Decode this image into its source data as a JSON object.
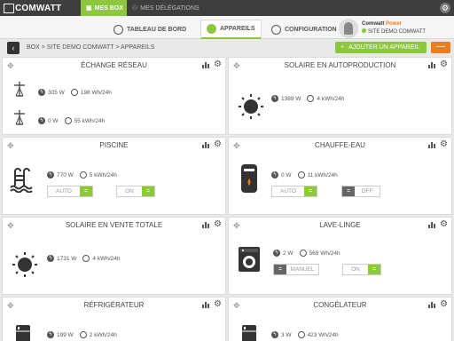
{
  "app": {
    "logo_text": "COMWATT",
    "tabs": {
      "mes_box": "MES BOX",
      "delegations": "MES DÉLÉGATIONS"
    }
  },
  "nav": {
    "tableau": "TABLEAU DE BORD",
    "appareils": "APPAREILS",
    "configuration": "CONFIGURATION"
  },
  "user": {
    "name": "Comwatt",
    "plan": "Power",
    "site": "SITE DEMO COMWATT"
  },
  "breadcrumb": "BOX > SITE DEMO COMWATT > APPAREILS",
  "actions": {
    "add": "AJOUTER UN APPAREIL",
    "remove": "—"
  },
  "colors": {
    "accent": "#8dc63f",
    "orange": "#e67e22",
    "dark": "#3e3e3e"
  },
  "devices": [
    {
      "title": "ÉCHANGE RÉSEAU",
      "rows": [
        {
          "power": "305 W",
          "energy": "198 Wh/24h"
        },
        {
          "power": "0 W",
          "energy": "55 kWh/24h"
        }
      ]
    },
    {
      "title": "SOLAIRE EN AUTOPRODUCTION",
      "power": "1389 W",
      "energy": "4 kWh/24h"
    },
    {
      "title": "PISCINE",
      "power": "770 W",
      "energy": "5 kWh/24h",
      "mode": "AUTO",
      "mode_knob": "=",
      "state": "ON",
      "state_knob": "="
    },
    {
      "title": "CHAUFFE-EAU",
      "power": "0 W",
      "energy": "11 kWh/24h",
      "mode": "AUTO",
      "mode_knob": "=",
      "state": "OFF",
      "state_knob": "="
    },
    {
      "title": "SOLAIRE EN VENTE TOTALE",
      "power": "1731 W",
      "energy": "4 kWh/24h"
    },
    {
      "title": "LAVE-LINGE",
      "power": "2 W",
      "energy": "569 Wh/24h",
      "mode": "MANUEL",
      "mode_knob": "=",
      "state": "ON",
      "state_knob": "="
    },
    {
      "title": "RÉFRIGÉRATEUR",
      "power": "199 W",
      "energy": "2 kWh/24h"
    },
    {
      "title": "CONGÉLATEUR",
      "power": "3 W",
      "energy": "423 Wh/24h"
    }
  ]
}
